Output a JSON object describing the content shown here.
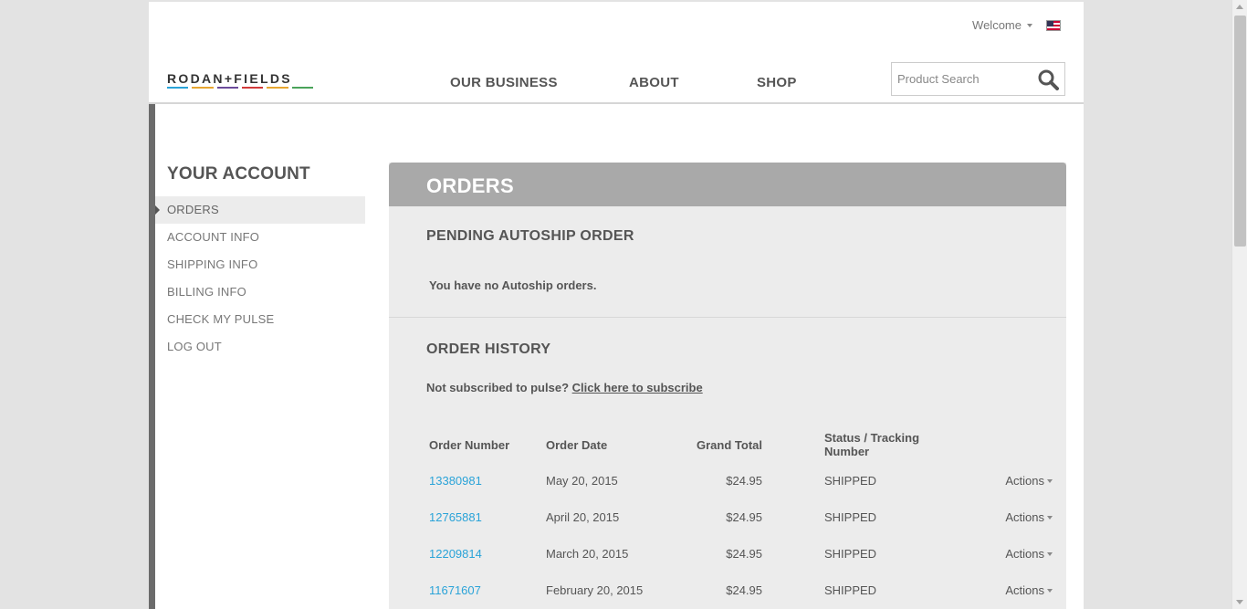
{
  "header": {
    "welcome_label": "Welcome",
    "logo_text": "RODAN+FIELDS",
    "logo_bar_colors": [
      "#2aa3d8",
      "#e8a630",
      "#6b4b9a",
      "#d23a3a",
      "#e8a630",
      "#4aa35a"
    ],
    "nav": [
      "OUR BUSINESS",
      "ABOUT",
      "SHOP"
    ],
    "search_placeholder": "Product Search"
  },
  "sidebar": {
    "title": "YOUR ACCOUNT",
    "items": [
      "ORDERS",
      "ACCOUNT INFO",
      "SHIPPING INFO",
      "BILLING INFO",
      "CHECK MY PULSE",
      "LOG OUT"
    ],
    "active_index": 0
  },
  "main": {
    "title": "ORDERS",
    "pending_title": "PENDING AUTOSHIP ORDER",
    "pending_message": "You have no Autoship orders.",
    "history_title": "ORDER HISTORY",
    "pulse_text": "Not subscribed to pulse?",
    "pulse_link": "Click here to subscribe",
    "columns": [
      "Order Number",
      "Order Date",
      "Grand Total",
      "Status / Tracking Number"
    ],
    "orders": [
      {
        "number": "13380981",
        "date": "May 20, 2015",
        "total": "$24.95",
        "status": "SHIPPED",
        "actions": "Actions"
      },
      {
        "number": "12765881",
        "date": "April 20, 2015",
        "total": "$24.95",
        "status": "SHIPPED",
        "actions": "Actions"
      },
      {
        "number": "12209814",
        "date": "March 20, 2015",
        "total": "$24.95",
        "status": "SHIPPED",
        "actions": "Actions"
      },
      {
        "number": "11671607",
        "date": "February 20, 2015",
        "total": "$24.95",
        "status": "SHIPPED",
        "actions": "Actions"
      }
    ]
  },
  "colors": {
    "link": "#2aa3d8",
    "panel_head": "#a9a9a9",
    "panel_bg": "#ececec"
  }
}
